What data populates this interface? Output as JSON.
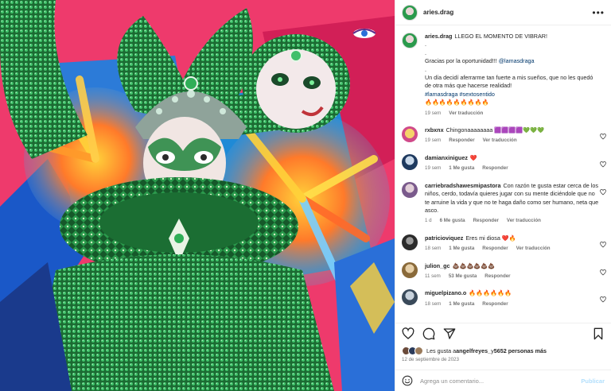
{
  "post": {
    "username": "aries.drag",
    "more_icon": "more-horizontal-icon"
  },
  "caption": {
    "username": "aries.drag",
    "line1": "LLEGO EL MOMENTO DE VIBRAR!",
    "dot1": ".",
    "dot2": ".",
    "thanks": "Gracias por la oportunidad!!! ",
    "mention": "@lamasdraga",
    "dot3": ".",
    "story": "Un día decidí aferrarme tan fuerte a mis sueños, que no les quedó de otra más que hacerse realidad!",
    "hashtags": "#lamasdraga #sextosentido",
    "fire": "🔥🔥🔥🔥🔥🔥🔥🔥🔥",
    "time": "19 sem",
    "translate": "Ver traducción"
  },
  "comments": [
    {
      "user": "rxbxnx",
      "text": "Chingonaaaaaaaa 🟪🟪🟪🟪💚💚💚",
      "time": "19 sem",
      "likes": "",
      "reply": "Responder",
      "translate": "Ver traducción",
      "avatar_color": "#e9a12b"
    },
    {
      "user": "damianxiniguez",
      "text": "❤️",
      "time": "19 sem",
      "likes": "1 Me gusta",
      "reply": "Responder",
      "translate": "",
      "avatar_color": "#1e3a5f"
    },
    {
      "user": "carriebradshawesmipastora",
      "text": "Con razón te gusta estar cerca de los niños, cerdo, todavía quieres jugar con su mente diciéndole que no te arruine la vida y que no te haga daño como ser humano, neta que asco.",
      "time": "1 d",
      "likes": "6 Me gusta",
      "reply": "Responder",
      "translate": "Ver traducción",
      "avatar_color": "#7a5a8c"
    },
    {
      "user": "patricioviquez",
      "text": "Eres mi diosa ❤️🔥",
      "time": "18 sem",
      "likes": "1 Me gusta",
      "reply": "Responder",
      "translate": "Ver traducción",
      "avatar_color": "#2b2b2b"
    },
    {
      "user": "julion_gc",
      "text": "💩💩💩💩💩💩",
      "time": "11 sem",
      "likes": "53 Me gusta",
      "reply": "Responder",
      "translate": "",
      "avatar_color": "#8a6a3a"
    },
    {
      "user": "miguelpizano.o",
      "text": "🔥🔥🔥🔥🔥🔥",
      "time": "18 sem",
      "likes": "1 Me gusta",
      "reply": "Responder",
      "translate": "",
      "avatar_color": "#3a4a5a"
    }
  ],
  "likes": {
    "prefix": "Les gusta a ",
    "user": "angelfreyes_",
    "mid": " y ",
    "count": "5652 personas más"
  },
  "date": "12 de septiembre de 2023",
  "add_comment": {
    "placeholder": "Agrega un comentario...",
    "publish": "Publicar"
  },
  "colors": {
    "accent_link": "#00376b",
    "publish_disabled": "#b2dffc",
    "muted": "#737373"
  }
}
